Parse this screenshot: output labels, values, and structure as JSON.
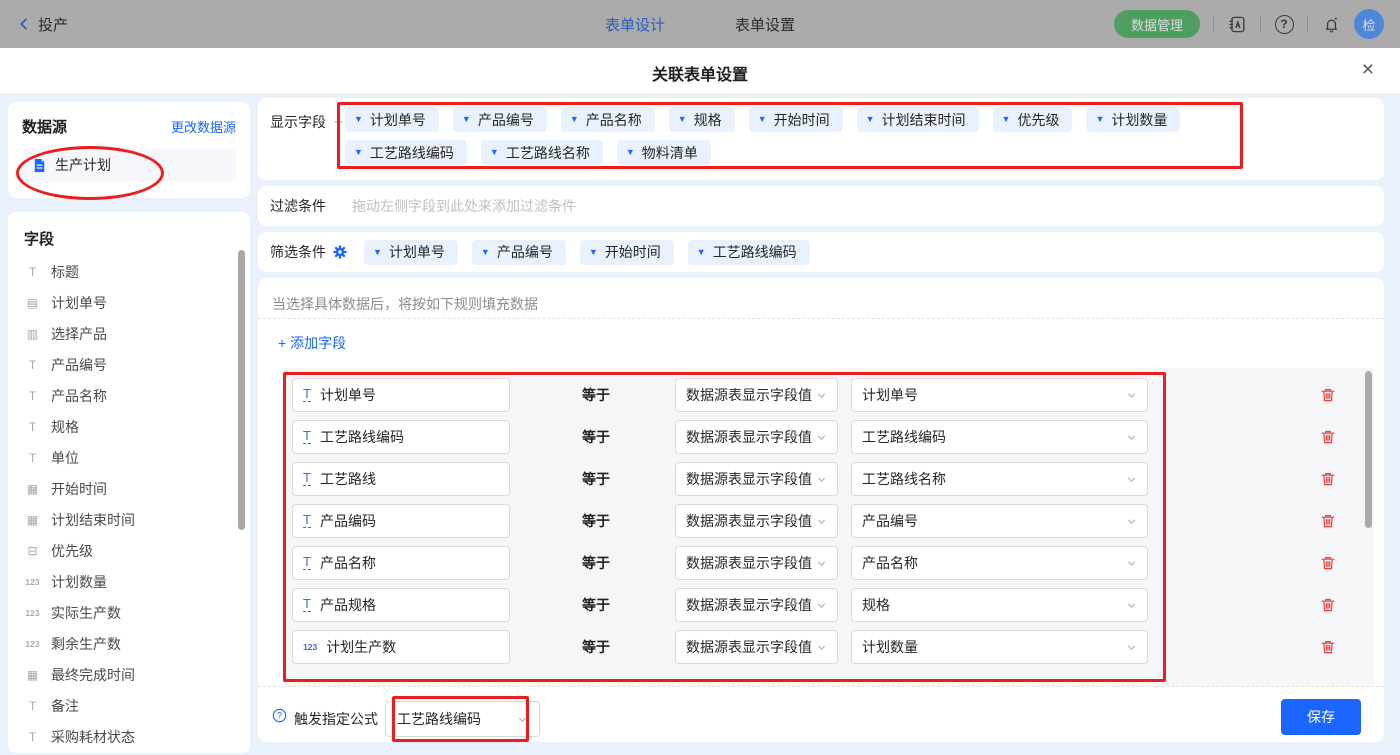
{
  "topbar": {
    "back_label": "投产",
    "tabs": [
      {
        "label": "表单设计",
        "active": true
      },
      {
        "label": "表单设置",
        "active": false
      }
    ],
    "data_manage_label": "数据管理",
    "avatar_text": "检"
  },
  "modal": {
    "title": "关联表单设置",
    "close_label": "×"
  },
  "sidebar": {
    "datasource_title": "数据源",
    "change_link": "更改数据源",
    "datasource_item": "生产计划",
    "fields_title": "字段",
    "fields": [
      {
        "icon": "title",
        "label": "标题"
      },
      {
        "icon": "autonum",
        "label": "计划单号"
      },
      {
        "icon": "relation",
        "label": "选择产品"
      },
      {
        "icon": "text",
        "label": "产品编号"
      },
      {
        "icon": "text",
        "label": "产品名称"
      },
      {
        "icon": "text",
        "label": "规格"
      },
      {
        "icon": "text",
        "label": "单位"
      },
      {
        "icon": "date",
        "label": "开始时间"
      },
      {
        "icon": "date",
        "label": "计划结束时间"
      },
      {
        "icon": "select",
        "label": "优先级"
      },
      {
        "icon": "number",
        "label": "计划数量"
      },
      {
        "icon": "number",
        "label": "实际生产数"
      },
      {
        "icon": "number",
        "label": "剩余生产数"
      },
      {
        "icon": "date",
        "label": "最终完成时间"
      },
      {
        "icon": "text",
        "label": "备注"
      },
      {
        "icon": "text",
        "label": "采购耗材状态"
      }
    ]
  },
  "display_fields": {
    "label": "显示字段",
    "add_button": "+",
    "chips": [
      "计划单号",
      "产品编号",
      "产品名称",
      "规格",
      "开始时间",
      "计划结束时间",
      "优先级",
      "计划数量",
      "工艺路线编码",
      "工艺路线名称",
      "物料清单"
    ]
  },
  "filter": {
    "label": "过滤条件",
    "placeholder": "拖动左侧字段到此处来添加过滤条件"
  },
  "screen": {
    "label": "筛选条件",
    "chips": [
      "计划单号",
      "产品编号",
      "开始时间",
      "工艺路线编码"
    ]
  },
  "rules": {
    "note": "当选择具体数据后，将按如下规则填充数据",
    "add_field_label": "+ 添加字段",
    "operator": "等于",
    "rows": [
      {
        "icon": "text",
        "field": "计划单号",
        "source": "数据源表显示字段值",
        "value": "计划单号"
      },
      {
        "icon": "text",
        "field": "工艺路线编码",
        "source": "数据源表显示字段值",
        "value": "工艺路线编码"
      },
      {
        "icon": "text",
        "field": "工艺路线",
        "source": "数据源表显示字段值",
        "value": "工艺路线名称"
      },
      {
        "icon": "text",
        "field": "产品编码",
        "source": "数据源表显示字段值",
        "value": "产品编号"
      },
      {
        "icon": "text",
        "field": "产品名称",
        "source": "数据源表显示字段值",
        "value": "产品名称"
      },
      {
        "icon": "text",
        "field": "产品规格",
        "source": "数据源表显示字段值",
        "value": "规格"
      },
      {
        "icon": "number",
        "field": "计划生产数",
        "source": "数据源表显示字段值",
        "value": "计划数量"
      }
    ]
  },
  "footer": {
    "trigger_label": "触发指定公式",
    "trigger_value": "工艺路线编码",
    "save_label": "保存"
  },
  "colors": {
    "accent": "#1a66ff",
    "chip_bg": "#e8f1fd",
    "annotation_red": "#ee1d1d",
    "danger": "#f23c3c",
    "topbar_green": "#4e9e62",
    "table_bg": "#f5f6f7"
  }
}
